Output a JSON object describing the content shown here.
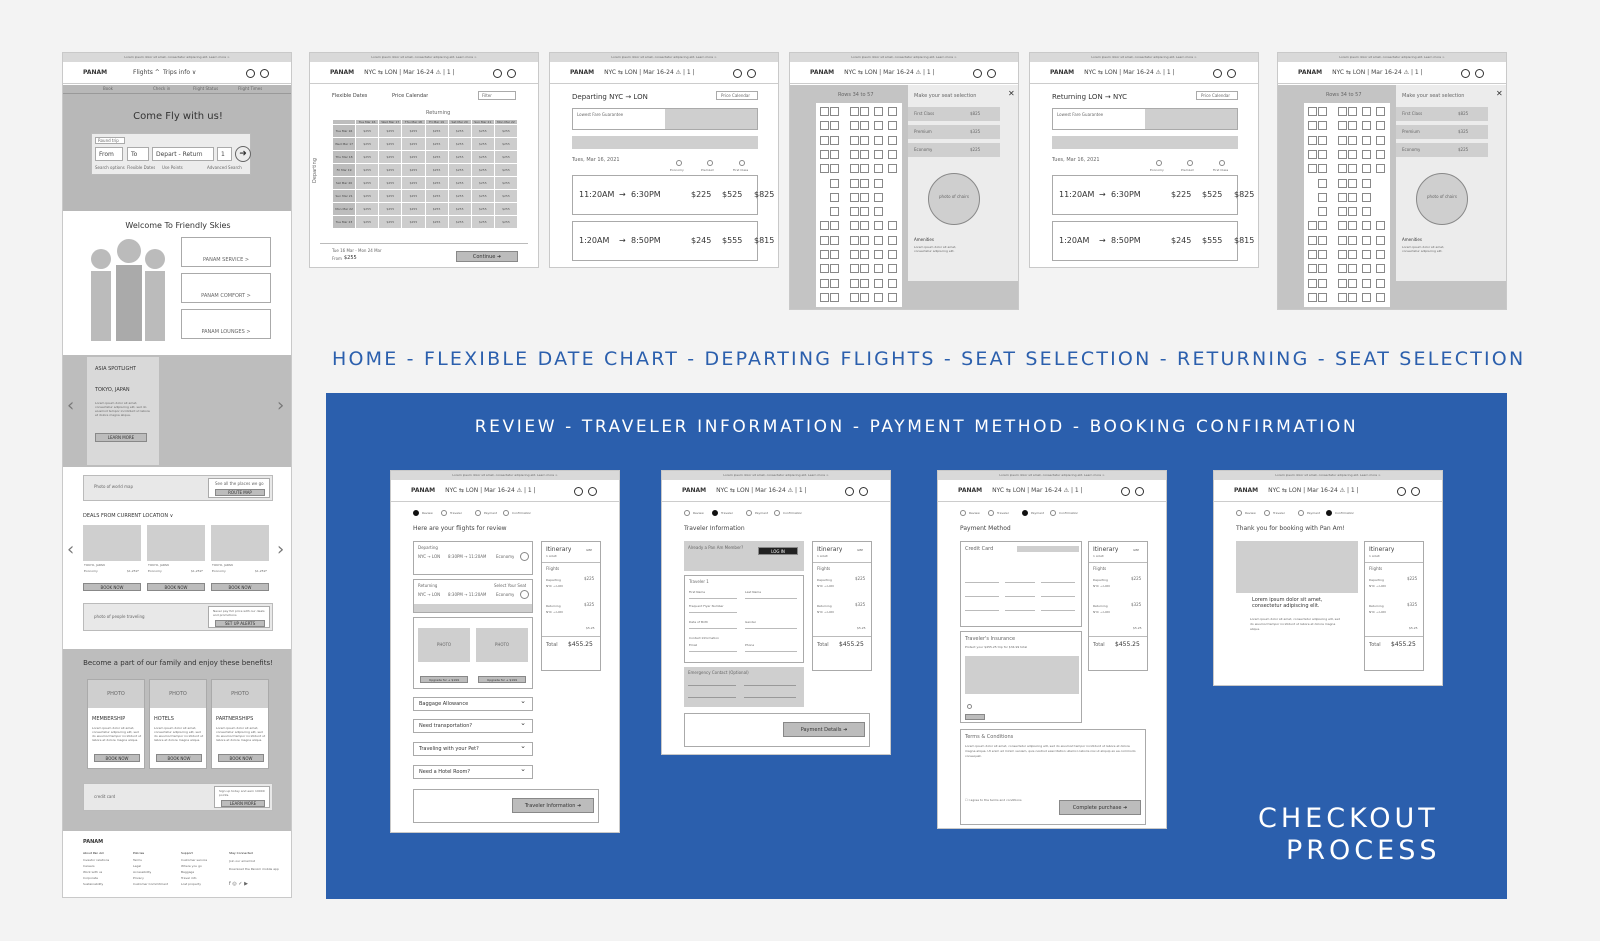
{
  "colors": {
    "accent": "#2b5fad",
    "wire_gray": "#cfcfcf",
    "background": "#f3f3f3"
  },
  "top_label": "HOME - FLEXIBLE DATE CHART - DEPARTING FLIGHTS - SEAT SELECTION - RETURNING - SEAT SELECTION",
  "checkout": {
    "header": "REVIEW - TRAVELER INFORMATION - PAYMENT METHOD - BOOKING CONFIRMATION",
    "label_line1": "CHECKOUT",
    "label_line2": "PROCESS"
  },
  "common": {
    "topbar": "Lorem ipsum dolor sit amet, consectetur adipiscing elit. Learn more >",
    "brand": "PANAM",
    "route": "NYC ⇆ LON | Mar 16-24 ⚠ | 1 |",
    "currency": "GBP",
    "steps": [
      "Review",
      "Traveler",
      "Payment",
      "Confirmation"
    ]
  },
  "home": {
    "nav": [
      "Flights ^",
      "Trips info ∨"
    ],
    "tabs": [
      "Book",
      "Check in",
      "Flight Status",
      "Flight Times"
    ],
    "hero": "Come Fly with us!",
    "trip_type": "Round trip",
    "from": "From",
    "to": "To",
    "dates": "Depart - Return",
    "pax": "1",
    "options": [
      "Search options",
      "Flexible Dates",
      "Use Points",
      "Advanced Search"
    ],
    "welcome": "Welcome To Friendly Skies",
    "links": [
      "PANAM SERVICE >",
      "PANAM COMFORT >",
      "PANAM LOUNGES >"
    ],
    "spotlight_title": "ASIA SPOTLIGHT",
    "spotlight_city": "TOKYO, JAPAN",
    "spotlight_text": "Lorem ipsum dolor sit amet, consectetur adipiscing elit, sed do eiusmod tempor incididunt ut labore et dolore magna aliqua.",
    "learn_more": "LEARN MORE",
    "map_label": "Photo of world map",
    "route_text": "See all the places we go",
    "route_btn": "ROUTE MAP",
    "deals": "DEALS FROM CURRENT LOCATION ∨",
    "deal_items": [
      {
        "city": "TOKYO, JAPAN",
        "class": "Economy",
        "price": "$1,259*"
      },
      {
        "city": "TOKYO, JAPAN",
        "class": "Economy",
        "price": "$1,259*"
      },
      {
        "city": "TOKYO, JAPAN",
        "class": "Economy",
        "price": "$1,259*"
      }
    ],
    "book_now": "BOOK NOW",
    "people_label": "photo of people traveling",
    "alerts_text": "Never pay full price with our deals and promotions",
    "alerts_btn": "SET UP ALERTS",
    "benefits": "Become a part of our family and enjoy these benefits!",
    "photo": "PHOTO",
    "benefit_titles": [
      "MEMBERSHIP",
      "HOTELS",
      "PARTNERSHIPS"
    ],
    "benefit_text": "Lorem ipsum dolor sit amet, consectetur adipiscing elit, sed do eiusmod tempor incididunt ut labore et dolore magna aliqua.",
    "credit_label": "credit card",
    "credit_text": "Sign up today and earn 10000 points.",
    "footer_brand": "PANAM",
    "footer_cols": [
      {
        "title": "About Pan Am",
        "items": [
          "Investor relations",
          "Careers",
          "Work with us",
          "Corporate",
          "Sustainability"
        ]
      },
      {
        "title": "Policies",
        "items": [
          "Terms",
          "Legal",
          "Accessibility",
          "Privacy",
          "Customer Commitment"
        ]
      },
      {
        "title": "Support",
        "items": [
          "Customer service",
          "Where you go",
          "Baggage",
          "Travel info",
          "Lost property"
        ]
      },
      {
        "title": "Stay Connected",
        "items": [
          "Join our email list",
          "Download the PanAm mobile app"
        ]
      }
    ]
  },
  "flex": {
    "tabs": [
      "Flexible Dates",
      "Price Calendar"
    ],
    "filter": "Filter",
    "returning": "Returning",
    "departing": "Departing",
    "cols": [
      "Tue Mar 16",
      "Wed Mar 17",
      "Thu Mar 18",
      "Fri Mar 19",
      "Sat Mar 20",
      "Sun Mar 21",
      "Mon Mar 22"
    ],
    "rows": [
      "Tue Mar 16",
      "Wed Mar 17",
      "Thu Mar 18",
      "Fri Mar 19",
      "Sat Mar 20",
      "Sun Mar 21",
      "Mon Mar 22",
      "Tue Mar 23"
    ],
    "cell": "$255",
    "footer_dates": "Tue 16 Mar - Mon 24 Mar",
    "from_price": "$255",
    "from_label": "From",
    "continue": "Continue"
  },
  "departing": {
    "title": "Departing NYC → LON",
    "calendar": "Price Calendar",
    "guarantee": "Lowest Fare Guarantee",
    "date": "Tues, Mar 16, 2021",
    "classes": [
      "Economy",
      "Premium",
      "First Class"
    ],
    "flights": [
      {
        "dep": "11:20AM",
        "arr": "6:30PM",
        "p1": "$225",
        "p2": "$525",
        "p3": "$825"
      },
      {
        "dep": "1:20AM",
        "arr": "8:50PM",
        "p1": "$245",
        "p2": "$555",
        "p3": "$815"
      }
    ]
  },
  "returning": {
    "title": "Returning LON → NYC",
    "calendar": "Price Calendar",
    "guarantee": "Lowest Fare Guarantee",
    "date": "Tues, Mar 16, 2021",
    "classes": [
      "Economy",
      "Premium",
      "First Class"
    ],
    "flights": [
      {
        "dep": "11:20AM",
        "arr": "6:30PM",
        "p1": "$225",
        "p2": "$525",
        "p3": "$825"
      },
      {
        "dep": "1:20AM",
        "arr": "8:50PM",
        "p1": "$245",
        "p2": "$555",
        "p3": "$815"
      }
    ]
  },
  "seat": {
    "rows": "Rows 34 to 57",
    "panel_title": "Make your seat selection",
    "options": [
      {
        "name": "First Class",
        "price": "$825"
      },
      {
        "name": "Premium",
        "price": "$325"
      },
      {
        "name": "Economy",
        "price": "$225"
      }
    ],
    "photo": "photo of chairs",
    "amenities": "Amenities",
    "amen_text": "Lorem ipsum dolor sit amet, consectetur adipiscing elit."
  },
  "itinerary": {
    "title": "Itinerary",
    "sub": "1 Adult",
    "flights": "Flights",
    "departing": "Departing",
    "returning": "Returning",
    "route": "NYC → LON",
    "price1": "$225",
    "price2": "$325",
    "taxes": "$5.25",
    "total_label": "Total",
    "total": "$455.25"
  },
  "review": {
    "heading": "Here are your flights for review",
    "departing": "Departing",
    "returning": "Returning",
    "route": "NYC → LON",
    "time": "8:30PM → 11:20AM",
    "class": "Economy",
    "seat_link": "Select Your Seat",
    "baggage": "Baggage Allowance",
    "transport": "Need transportation?",
    "pet": "Traveling with your Pet?",
    "hotel": "Need a Hotel Room?",
    "next": "Traveler Information",
    "photo": "PHOTO",
    "upgrade": "Upgrade for + $199"
  },
  "traveler": {
    "heading": "Traveler Information",
    "member": "Already a Pan Am Member?",
    "login": "LOG IN",
    "traveler1": "Traveler 1",
    "emergency": "Emergency Contact (Optional)",
    "next": "Payment Details",
    "fields": [
      "First Name",
      "Last Name",
      "Frequent Flyer Number",
      "Date of Birth",
      "Gender",
      "Contact Information",
      "Email",
      "Phone"
    ]
  },
  "payment": {
    "heading": "Payment Method",
    "card": "Credit Card",
    "insurance": "Traveler's Insurance",
    "insurance_text": "Protect your $455.25 trip for $34.99 total",
    "terms": "Terms & Conditions",
    "terms_text": "Lorem ipsum dolor sit amet, consectetur adipiscing elit, sed do eiusmod tempor incididunt ut labore et dolore magna aliqua. Ut enim ad minim veniam, quis nostrud exercitation ullamco laboris nisi ut aliquip ex ea commodo consequat.",
    "agree": "I agree to the terms and conditions",
    "complete": "Complete purchase"
  },
  "confirm": {
    "heading": "Thank you for booking with Pan Am!",
    "text": "Lorem ipsum dolor sit amet, consectetur adipiscing elit.",
    "body": "Lorem ipsum dolor sit amet, consectetur adipiscing elit, sed do eiusmod tempor incididunt ut labore et dolore magna aliqua."
  }
}
